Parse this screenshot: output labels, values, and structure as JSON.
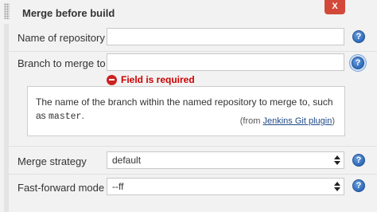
{
  "header": {
    "title": "Merge before build",
    "close_label": "X"
  },
  "fields": {
    "repository": {
      "label": "Name of repository",
      "value": ""
    },
    "branch": {
      "label": "Branch to merge to",
      "value": "",
      "error": "Field is required"
    },
    "help": {
      "text_before": "The name of the branch within the named repository to merge to, such as",
      "code": "master",
      "text_after": ".",
      "source_prefix": "(from ",
      "source_link": "Jenkins Git plugin",
      "source_suffix": ")"
    },
    "strategy": {
      "label": "Merge strategy",
      "selected": "default"
    },
    "fast_forward": {
      "label": "Fast-forward mode",
      "selected": "--ff"
    }
  },
  "icons": {
    "help": "?",
    "help_icon_name": "help-circle-icon",
    "error_icon_name": "error-circle-icon",
    "grip_icon_name": "drag-handle-icon"
  },
  "colors": {
    "close_button": "#d24939",
    "error_text": "#cc0000",
    "help_icon": "#2e6ab8",
    "link": "#204a87"
  }
}
